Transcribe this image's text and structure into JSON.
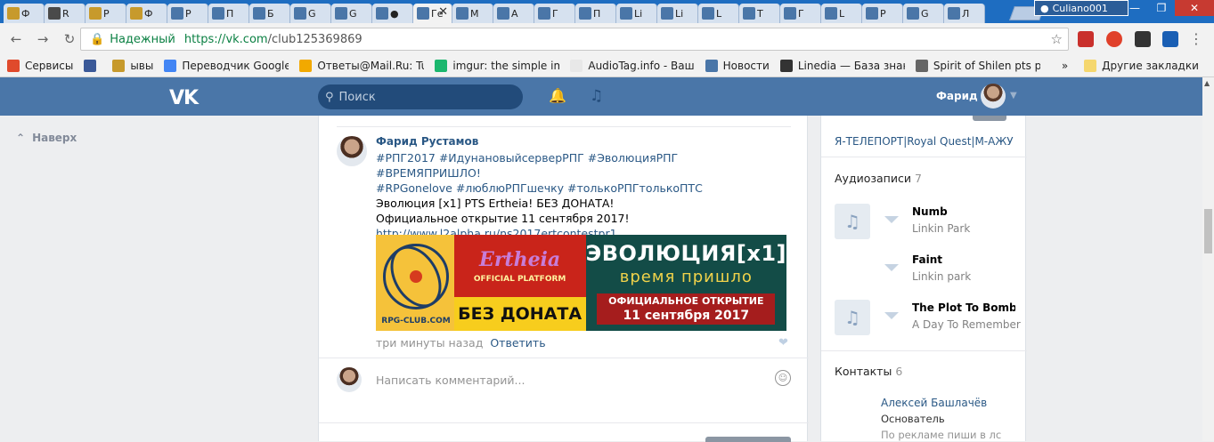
{
  "browser": {
    "tabs": [
      {
        "label": "Ф",
        "color": "#c79a2c"
      },
      {
        "label": "R",
        "color": "#4a4a4a"
      },
      {
        "label": "Р",
        "color": "#c79a2c"
      },
      {
        "label": "Ф",
        "color": "#c79a2c"
      },
      {
        "label": "Р",
        "color": "#4a76a8"
      },
      {
        "label": "П",
        "color": "#4a76a8"
      },
      {
        "label": "Б",
        "color": "#4a76a8"
      },
      {
        "label": "G",
        "color": "#4a76a8"
      },
      {
        "label": "G",
        "color": "#4a76a8"
      },
      {
        "label": "●",
        "color": "#4a76a8"
      },
      {
        "label": "Ге",
        "color": "#4a76a8",
        "active": true
      },
      {
        "label": "М",
        "color": "#4a76a8"
      },
      {
        "label": "А",
        "color": "#4a76a8"
      },
      {
        "label": "Г",
        "color": "#4a76a8"
      },
      {
        "label": "П",
        "color": "#4a76a8"
      },
      {
        "label": "Li",
        "color": "#4a76a8"
      },
      {
        "label": "Li",
        "color": "#4a76a8"
      },
      {
        "label": "L",
        "color": "#4a76a8"
      },
      {
        "label": "Т",
        "color": "#4a76a8"
      },
      {
        "label": "Г",
        "color": "#4a76a8"
      },
      {
        "label": "L",
        "color": "#4a76a8"
      },
      {
        "label": "Р",
        "color": "#4a76a8"
      },
      {
        "label": "G",
        "color": "#4a76a8"
      },
      {
        "label": "Л",
        "color": "#4a76a8"
      }
    ],
    "profile_name": "Culiano001",
    "secure_label": "Надежный",
    "url_host": "https://vk.com",
    "url_path": "/club125369869",
    "bookmarks": [
      {
        "label": "Сервисы",
        "color": "#e04a2c"
      },
      {
        "label": "",
        "color": "#3b5998"
      },
      {
        "label": "ывы",
        "color": "#c79a2c"
      },
      {
        "label": "Переводчик Google",
        "color": "#4285f4"
      },
      {
        "label": "Ответы@Mail.Ru: Tur",
        "color": "#f2a900"
      },
      {
        "label": "imgur: the simple ima",
        "color": "#1bb76e"
      },
      {
        "label": "AudioTag.info - Ваш",
        "color": "#e8e8e8"
      },
      {
        "label": "Новости",
        "color": "#4a76a8"
      },
      {
        "label": "Linedia — База знан",
        "color": "#333333"
      },
      {
        "label": "Spirit of Shilen pts pa",
        "color": "#666666"
      }
    ],
    "overflow": "»",
    "other_bookmarks": "Другие закладки"
  },
  "vk": {
    "search_placeholder": "Поиск",
    "user_name": "Фарид",
    "up_label": "Наверх"
  },
  "post": {
    "author": "Фарид Рустамов",
    "hashtags_line1": "#РПГ2017 #ИдунановыйсерверРПГ #ЭволюцияРПГ #ВРЕМЯПРИШЛО!",
    "hashtags_line2": "#RPGonelove #люблюРПГшечку #толькоРПГтолькоПТС",
    "line3": "Эволюция [x1] PTS Ertheia! БЕЗ ДОНАТА!",
    "line4": "Официальное открытие 11 сентября 2017!",
    "link": "http://www.l2alpha.ru/ns2017ertcontestpr1",
    "banner": {
      "rpg_club": "RPG-CLUB.COM",
      "ertheia": "Ertheia",
      "official_platform": "OFFICIAL PLATFORM",
      "no_donate": "БЕЗ ДОНАТА",
      "evolution": "ЭВОЛЮЦИЯ[x1]",
      "time_has_come": "время пришло",
      "official_opening": "ОФИЦИАЛЬНОЕ ОТКРЫТИЕ",
      "date": "11 сентября 2017"
    },
    "time": "три минуты назад",
    "reply": "Ответить",
    "comment_placeholder": "Написать комментарий..."
  },
  "sidebar": {
    "teleport_text": "Я-ТЕЛЕПОРТ|Royal Quest|М-АЖУ",
    "audio_title": "Аудиозаписи",
    "audio_count": "7",
    "tracks": [
      {
        "title": "Numb",
        "artist": "Linkin Park",
        "has_cover": true
      },
      {
        "title": "Faint",
        "artist": "Linkin park",
        "has_cover": false
      },
      {
        "title": "The Plot To Bomb ...",
        "artist": "A Day To Remember",
        "has_cover": true
      }
    ],
    "contacts_title": "Контакты",
    "contacts_count": "6",
    "contact_name": "Алексей Башлачёв",
    "contact_role": "Основатель",
    "contact_note": "По рекламе пиши в лс"
  }
}
